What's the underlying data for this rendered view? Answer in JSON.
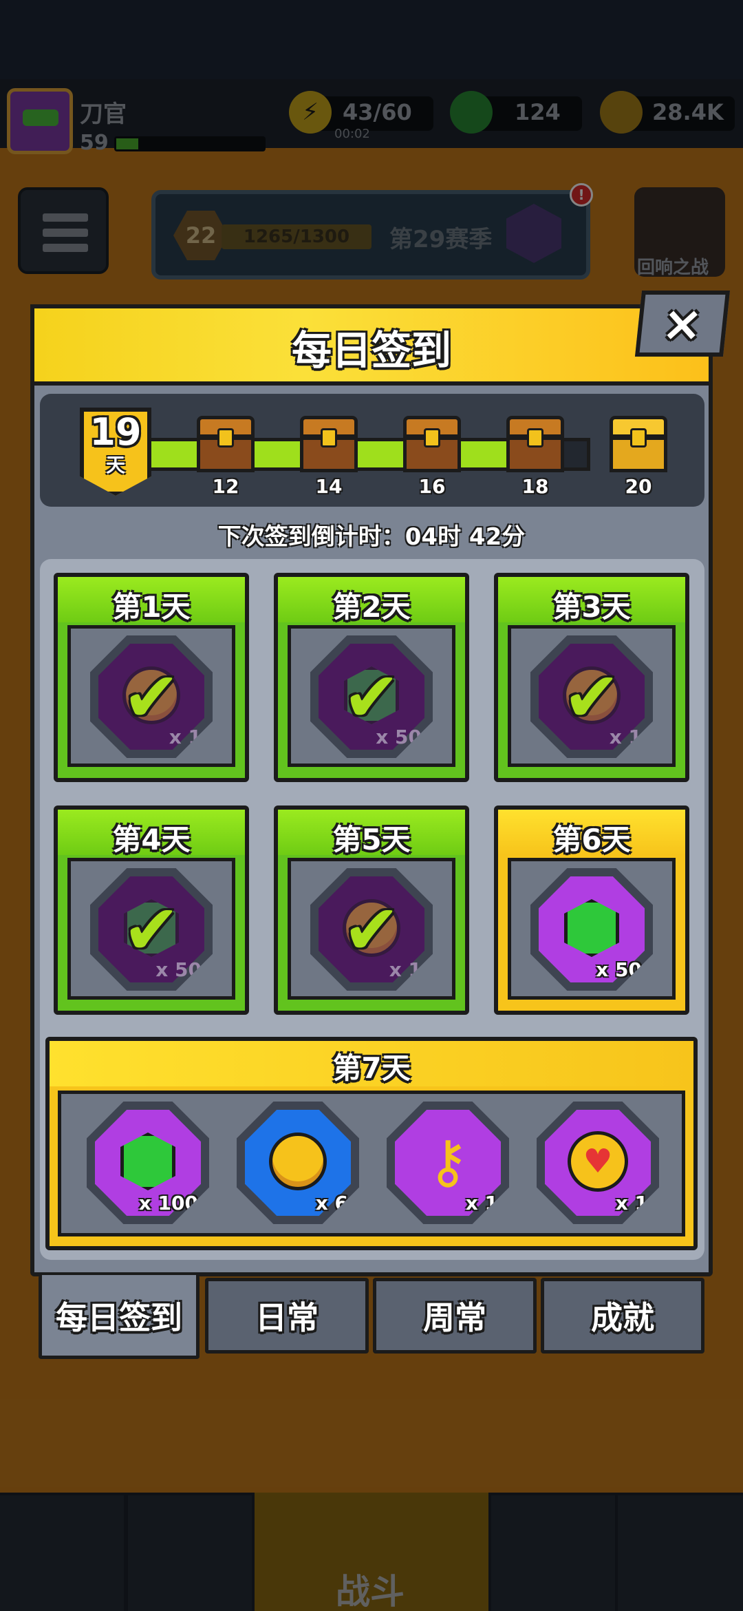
{
  "player": {
    "name": "刀官",
    "level": "59"
  },
  "resources": {
    "energy": "43/60",
    "energy_timer": "00:02",
    "gems": "124",
    "coins": "28.4K"
  },
  "season": {
    "level": "22",
    "progress": "1265/1300",
    "title": "第29赛季"
  },
  "echo_battle": {
    "label": "回响之战"
  },
  "dialog": {
    "title": "每日签到",
    "close_icon": "×",
    "streak": {
      "days": "19",
      "unit": "天",
      "current": 19,
      "max": 20
    },
    "milestones": [
      "12",
      "14",
      "16",
      "18",
      "20"
    ],
    "countdown": "下次签到倒计时：04时 42分",
    "days": [
      {
        "label": "第1天",
        "item": "coin",
        "qty": "x 1",
        "claimed": true
      },
      {
        "label": "第2天",
        "item": "gem",
        "qty": "x 50",
        "claimed": true
      },
      {
        "label": "第3天",
        "item": "coin",
        "qty": "x 1",
        "claimed": true
      },
      {
        "label": "第4天",
        "item": "gem",
        "qty": "x 50",
        "claimed": true
      },
      {
        "label": "第5天",
        "item": "coin",
        "qty": "x 1",
        "claimed": true
      },
      {
        "label": "第6天",
        "item": "gem",
        "qty": "x 50",
        "claimed": false
      }
    ],
    "day7": {
      "label": "第7天",
      "rewards": [
        {
          "item": "gem",
          "qty": "x 100"
        },
        {
          "item": "speed-coin",
          "qty": "x 6"
        },
        {
          "item": "key",
          "qty": "x 1"
        },
        {
          "item": "heart-coin",
          "qty": "x 1"
        }
      ]
    },
    "tabs": [
      "每日签到",
      "日常",
      "周常",
      "成就"
    ]
  },
  "bottom_nav": {
    "battle_label": "战斗"
  },
  "badges": {
    "alert": "!"
  },
  "colors": {
    "claimed": "#62c31e",
    "today": "#f7c41b",
    "header": "#fbd52a"
  }
}
